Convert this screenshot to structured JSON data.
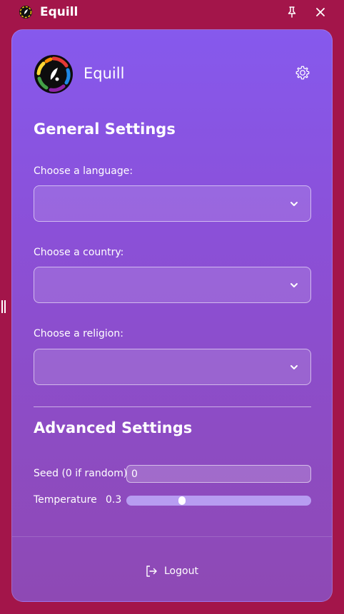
{
  "window": {
    "title": "Equill"
  },
  "brand": {
    "name": "Equill"
  },
  "general": {
    "title": "General Settings",
    "language": {
      "label": "Choose a language:",
      "value": ""
    },
    "country": {
      "label": "Choose a country:",
      "value": ""
    },
    "religion": {
      "label": "Choose a religion:",
      "value": ""
    }
  },
  "advanced": {
    "title": "Advanced Settings",
    "seed": {
      "label": "Seed (0 if random)",
      "value": "0"
    },
    "temperature": {
      "label": "Temperature",
      "display": "0.3",
      "fraction": 0.3
    }
  },
  "footer": {
    "logout_label": "Logout"
  },
  "icons": {
    "pin": "pin-icon",
    "close": "close-icon",
    "gear": "gear-icon",
    "chevron": "chevron-down-icon",
    "logout": "logout-icon"
  },
  "colors": {
    "window_bg": "#a3154a",
    "panel_top": "#8659ed",
    "panel_bottom": "#8e49b4",
    "text": "#ffffff"
  }
}
